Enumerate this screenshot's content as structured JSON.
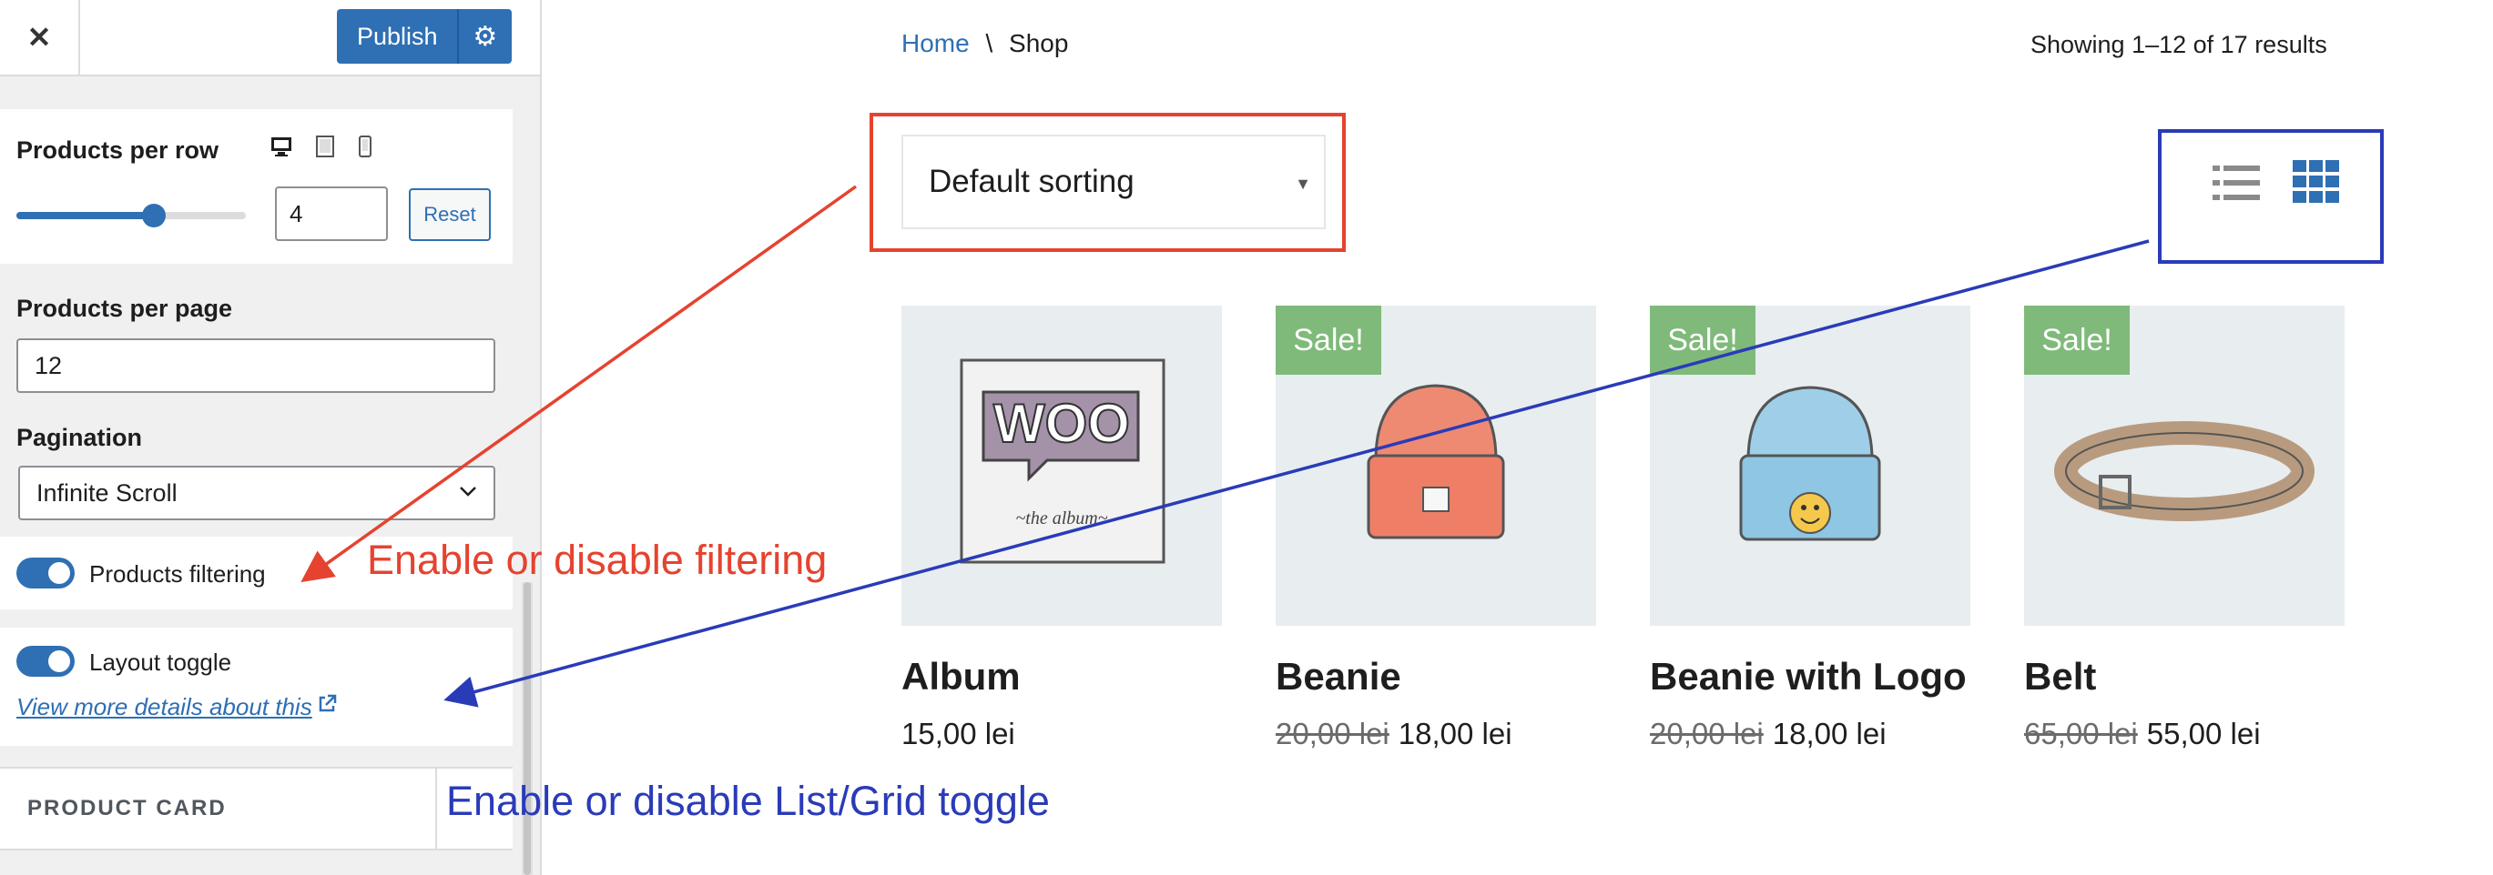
{
  "customizer": {
    "close_glyph": "✕",
    "publish_label": "Publish",
    "products_per_row": {
      "label": "Products per row",
      "slider_fraction": 0.6,
      "value": "4",
      "reset_label": "Reset"
    },
    "products_per_page": {
      "label": "Products per page",
      "value": "12"
    },
    "pagination": {
      "label": "Pagination",
      "selected": "Infinite Scroll"
    },
    "products_filtering": {
      "label": "Products filtering",
      "enabled": true
    },
    "layout_toggle": {
      "label": "Layout toggle",
      "enabled": true
    },
    "details_link": "View more details about this",
    "section_product_card": "PRODUCT CARD"
  },
  "shop": {
    "breadcrumb": {
      "home": "Home",
      "separator": "\\",
      "current": "Shop"
    },
    "results_count": "Showing 1–12 of 17 results",
    "sorting": {
      "selected": "Default sorting"
    },
    "view_toggle": {
      "active": "grid"
    },
    "products": [
      {
        "name": "Album",
        "old_price": "",
        "price": "15,00 lei",
        "sale": false,
        "badge": "",
        "image": "album-image"
      },
      {
        "name": "Beanie",
        "old_price": "20,00 lei",
        "price": "18,00 lei",
        "sale": true,
        "badge": "Sale!",
        "image": "beanie-image"
      },
      {
        "name": "Beanie with Logo",
        "old_price": "20,00 lei",
        "price": "18,00 lei",
        "sale": true,
        "badge": "Sale!",
        "image": "beanie-logo-image"
      },
      {
        "name": "Belt",
        "old_price": "65,00 lei",
        "price": "55,00 lei",
        "sale": true,
        "badge": "Sale!",
        "image": "belt-image"
      }
    ]
  },
  "annotations": {
    "filtering": "Enable or disable filtering",
    "layout_toggle": "Enable or disable List/Grid toggle"
  },
  "colors": {
    "accent": "#2f6fb3",
    "annotation_red": "#e5432f",
    "annotation_blue": "#2a3bb8",
    "sale_badge": "#7fba7a"
  }
}
